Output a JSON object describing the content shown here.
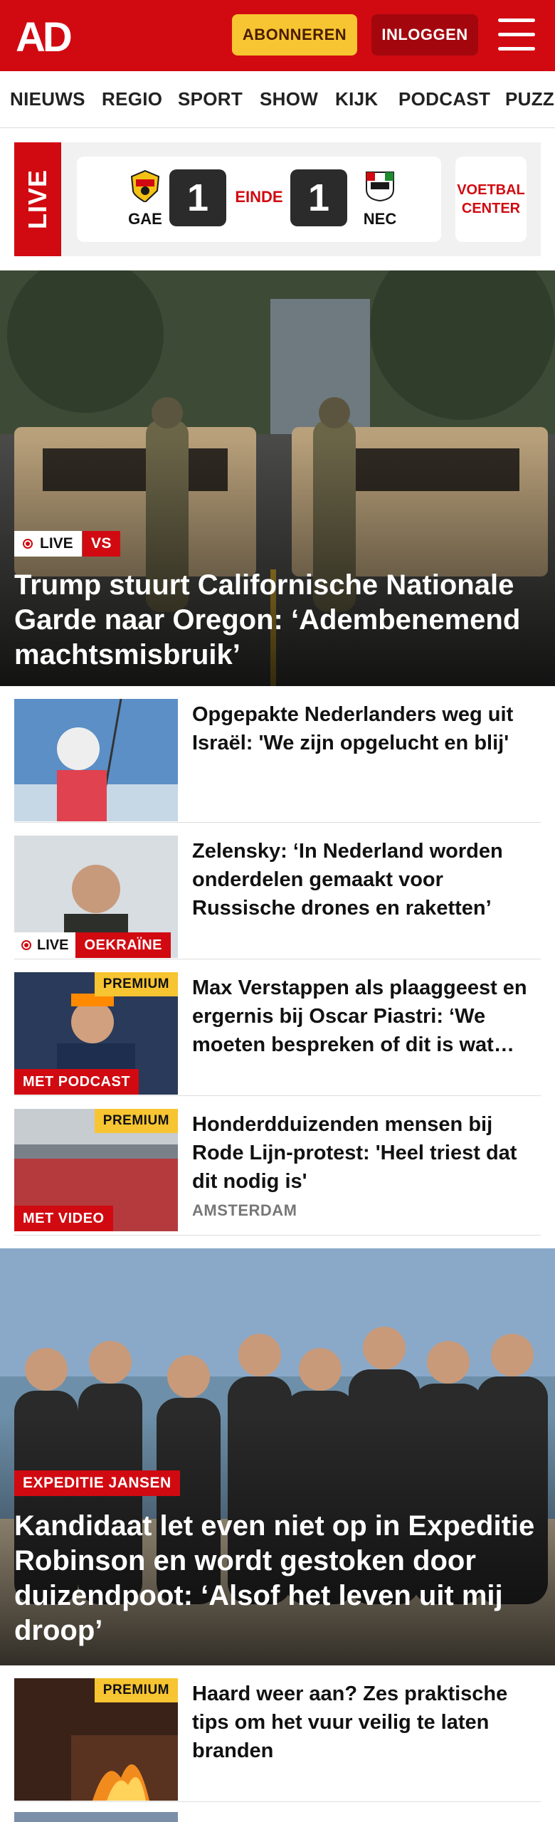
{
  "header": {
    "logo_text": "AD",
    "subscribe_label": "ABONNEREN",
    "login_label": "INLOGGEN",
    "menu_icon": "hamburger-menu-icon",
    "brand_color": "#d10a11"
  },
  "nav": {
    "items": [
      {
        "label": "NIEUWS"
      },
      {
        "label": "REGIO"
      },
      {
        "label": "SPORT"
      },
      {
        "label": "SHOW"
      },
      {
        "label": "KIJK"
      },
      {
        "label": "PODCAST"
      },
      {
        "label": "PUZZ"
      }
    ]
  },
  "live_score": {
    "live_label": "LIVE",
    "home_team": "GAE",
    "home_score": "1",
    "status": "EINDE",
    "away_score": "1",
    "away_team": "NEC",
    "center_label_1": "VOETBAL",
    "center_label_2": "CENTER"
  },
  "hero1": {
    "live_label": "LIVE",
    "tag": "VS",
    "title": "Trump stuurt Californische Nationale Garde naar Oregon: ‘Adembenemend machtsmisbruik’"
  },
  "articles": [
    {
      "title": "Opgepakte Nederlanders weg uit Israël: 'We zijn opgelucht en blij'"
    },
    {
      "title": "Zelensky: ‘In Nederland worden onderdelen gemaakt voor Russische drones en raketten’",
      "live_label": "LIVE",
      "tag": "OEKRAÏNE"
    },
    {
      "title": "Max Verstappen als plaaggeest en ergernis bij Oscar Piastri: ‘We moeten bespreken of dit is wat…",
      "premium": "PREMIUM",
      "label": "MET PODCAST"
    },
    {
      "title": "Honderdduizenden mensen bij Rode Lijn-protest: 'Heel triest dat dit nodig is'",
      "kicker": "AMSTERDAM",
      "premium": "PREMIUM",
      "label": "MET VIDEO"
    }
  ],
  "hero2": {
    "tag": "EXPEDITIE JANSEN",
    "title": "Kandidaat let even niet op in Expeditie Robinson en wordt gestoken door duizendpoot: ‘Alsof het leven uit mij droop’"
  },
  "articles2": [
    {
      "title": "Haard weer aan? Zes praktische tips om het vuur veilig te laten branden",
      "premium": "PREMIUM"
    }
  ]
}
